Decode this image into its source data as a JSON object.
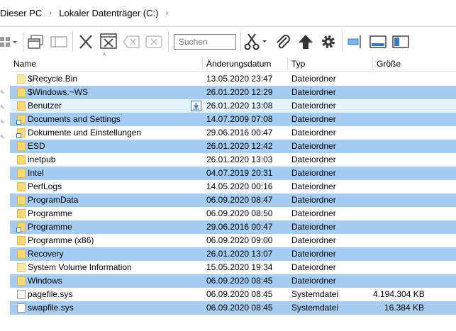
{
  "breadcrumb": {
    "items": [
      "Dieser PC",
      "Lokaler Datenträger (C:)"
    ],
    "separator": "›"
  },
  "toolbar": {
    "search_placeholder": "Suchen"
  },
  "columns": {
    "name": "Name",
    "date": "Änderungsdatum",
    "type": "Typ",
    "size": "Größe"
  },
  "files": [
    {
      "name": "$Recycle.Bin",
      "date": "13.05.2020 23:47",
      "type": "Dateiordner",
      "size": "",
      "icon": "folder-light-icon",
      "state": ""
    },
    {
      "name": "$Windows.~WS",
      "date": "26.01.2020 12:29",
      "type": "Dateiordner",
      "size": "",
      "icon": "folder-icon",
      "state": "sel"
    },
    {
      "name": "Benutzer",
      "date": "26.01.2020 13:08",
      "type": "Dateiordner",
      "size": "",
      "icon": "folder-icon",
      "state": "hover"
    },
    {
      "name": "Documents and Settings",
      "date": "14.07.2009 07:08",
      "type": "Dateiordner",
      "size": "",
      "icon": "folder-shortcut-icon",
      "state": "sel"
    },
    {
      "name": "Dokumente und Einstellungen",
      "date": "29.06.2016 00:47",
      "type": "Dateiordner",
      "size": "",
      "icon": "folder-shortcut-icon",
      "state": ""
    },
    {
      "name": "ESD",
      "date": "26.01.2020 12:42",
      "type": "Dateiordner",
      "size": "",
      "icon": "folder-icon",
      "state": "sel"
    },
    {
      "name": "inetpub",
      "date": "26.01.2020 13:03",
      "type": "Dateiordner",
      "size": "",
      "icon": "folder-icon",
      "state": ""
    },
    {
      "name": "Intel",
      "date": "04.07.2019 20:31",
      "type": "Dateiordner",
      "size": "",
      "icon": "folder-icon",
      "state": "sel"
    },
    {
      "name": "PerfLogs",
      "date": "14.05.2020 00:16",
      "type": "Dateiordner",
      "size": "",
      "icon": "folder-icon",
      "state": ""
    },
    {
      "name": "ProgramData",
      "date": "06.09.2020 08:47",
      "type": "Dateiordner",
      "size": "",
      "icon": "folder-icon",
      "state": "sel"
    },
    {
      "name": "Programme",
      "date": "06.09.2020 08:50",
      "type": "Dateiordner",
      "size": "",
      "icon": "folder-icon",
      "state": ""
    },
    {
      "name": "Programme",
      "date": "29.06.2016 00:47",
      "type": "Dateiordner",
      "size": "",
      "icon": "folder-shortcut-icon",
      "state": "sel"
    },
    {
      "name": "Programme (x86)",
      "date": "06.09.2020 09:00",
      "type": "Dateiordner",
      "size": "",
      "icon": "folder-icon",
      "state": ""
    },
    {
      "name": "Recovery",
      "date": "26.01.2020 13:07",
      "type": "Dateiordner",
      "size": "",
      "icon": "folder-icon",
      "state": "sel"
    },
    {
      "name": "System Volume Information",
      "date": "15.05.2020 19:34",
      "type": "Dateiordner",
      "size": "",
      "icon": "folder-light-icon",
      "state": ""
    },
    {
      "name": "Windows",
      "date": "06.09.2020 08:45",
      "type": "Dateiordner",
      "size": "",
      "icon": "folder-icon",
      "state": "sel"
    },
    {
      "name": "pagefile.sys",
      "date": "06.09.2020 08:45",
      "type": "Systemdatei",
      "size": "4.194.304 KB",
      "icon": "file-icon",
      "state": ""
    },
    {
      "name": "swapfile.sys",
      "date": "06.09.2020 08:45",
      "type": "Systemdatei",
      "size": "16.384 KB",
      "icon": "file-icon",
      "state": "sel"
    }
  ],
  "colors": {
    "selection": "#a6cdf1",
    "hover": "#e5f3ff",
    "folder": "#f8d775",
    "accent": "#3b78c2"
  }
}
